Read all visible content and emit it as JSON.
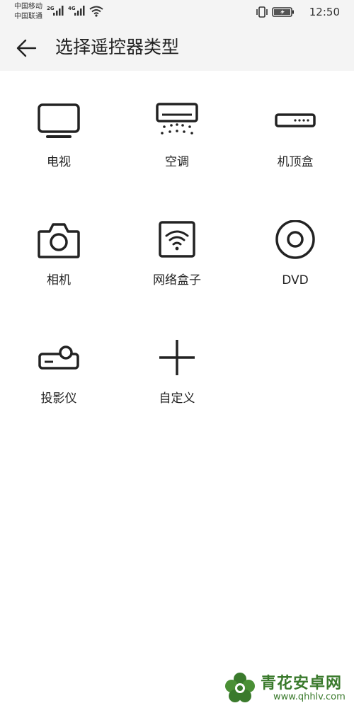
{
  "status_bar": {
    "carrier1": "中国移动",
    "carrier2": "中国联通",
    "net1": "2G",
    "net2": "4G",
    "time": "12:50"
  },
  "header": {
    "title": "选择遥控器类型"
  },
  "devices": [
    {
      "label": "电视",
      "icon": "tv-icon"
    },
    {
      "label": "空调",
      "icon": "air-conditioner-icon"
    },
    {
      "label": "机顶盒",
      "icon": "set-top-box-icon"
    },
    {
      "label": "相机",
      "icon": "camera-icon"
    },
    {
      "label": "网络盒子",
      "icon": "network-box-icon"
    },
    {
      "label": "DVD",
      "icon": "dvd-icon"
    },
    {
      "label": "投影仪",
      "icon": "projector-icon"
    },
    {
      "label": "自定义",
      "icon": "plus-icon"
    }
  ],
  "watermark": {
    "name": "青花安卓网",
    "url": "www.qhhlv.com",
    "color": "#3a7a2c"
  }
}
